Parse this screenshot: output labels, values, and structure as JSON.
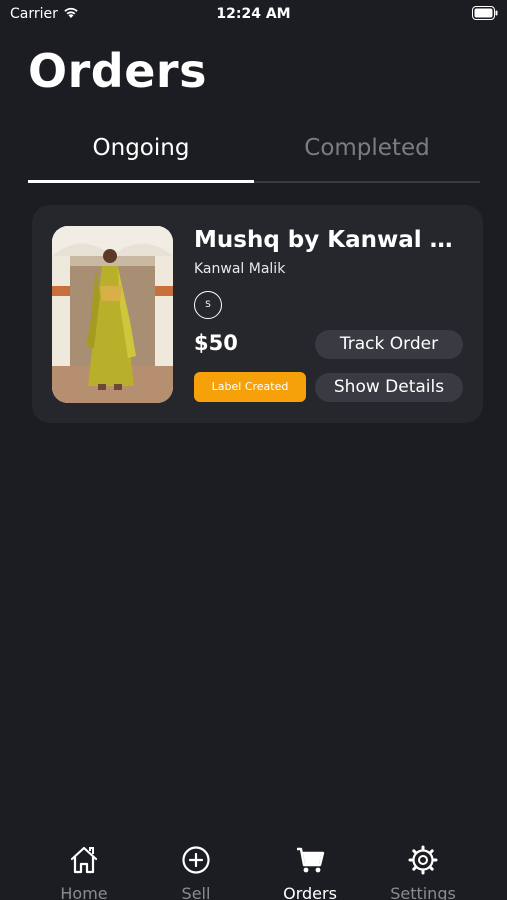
{
  "status_bar": {
    "carrier": "Carrier",
    "time": "12:24 AM"
  },
  "page": {
    "title": "Orders"
  },
  "tabs": [
    {
      "label": "Ongoing",
      "active": true
    },
    {
      "label": "Completed",
      "active": false
    }
  ],
  "order": {
    "product_name": "Mushq by Kanwal M...",
    "seller": "Kanwal Malik",
    "size": "S",
    "price": "$50",
    "status": "Label Created",
    "track_label": "Track Order",
    "details_label": "Show Details"
  },
  "nav": [
    {
      "label": "Home",
      "icon": "home-icon"
    },
    {
      "label": "Sell",
      "icon": "plus-circle-icon"
    },
    {
      "label": "Orders",
      "icon": "cart-icon",
      "active": true
    },
    {
      "label": "Settings",
      "icon": "gear-icon"
    }
  ],
  "colors": {
    "background": "#1c1d22",
    "card": "#26272d",
    "status_badge": "#f6a10a",
    "button": "#3a3b42",
    "inactive_text": "#7c7d82"
  }
}
